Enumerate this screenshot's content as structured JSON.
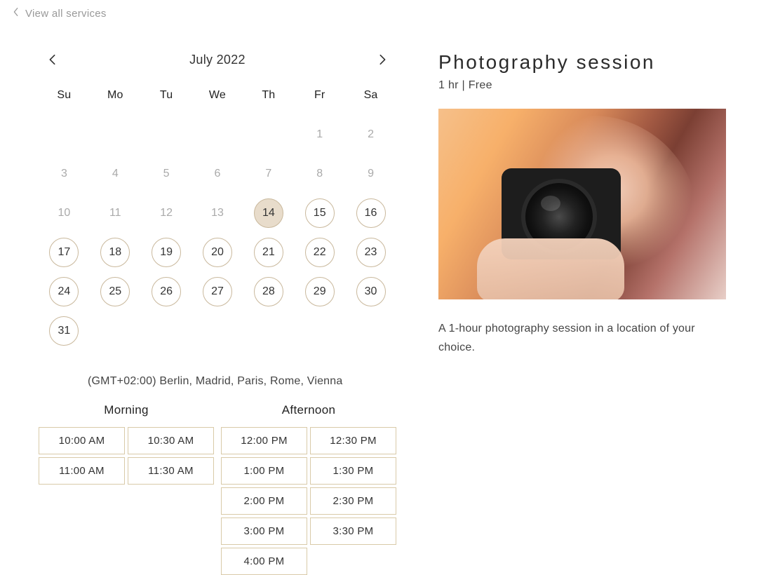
{
  "back": {
    "label": "View all services"
  },
  "calendar": {
    "title": "July 2022",
    "dow": [
      "Su",
      "Mo",
      "Tu",
      "We",
      "Th",
      "Fr",
      "Sa"
    ],
    "leading_blanks": 5,
    "days": [
      {
        "n": "1",
        "state": "disabled"
      },
      {
        "n": "2",
        "state": "disabled"
      },
      {
        "n": "3",
        "state": "disabled"
      },
      {
        "n": "4",
        "state": "disabled"
      },
      {
        "n": "5",
        "state": "disabled"
      },
      {
        "n": "6",
        "state": "disabled"
      },
      {
        "n": "7",
        "state": "disabled"
      },
      {
        "n": "8",
        "state": "disabled"
      },
      {
        "n": "9",
        "state": "disabled"
      },
      {
        "n": "10",
        "state": "disabled"
      },
      {
        "n": "11",
        "state": "disabled"
      },
      {
        "n": "12",
        "state": "disabled"
      },
      {
        "n": "13",
        "state": "disabled"
      },
      {
        "n": "14",
        "state": "selected"
      },
      {
        "n": "15",
        "state": "available"
      },
      {
        "n": "16",
        "state": "available"
      },
      {
        "n": "17",
        "state": "available"
      },
      {
        "n": "18",
        "state": "available"
      },
      {
        "n": "19",
        "state": "available"
      },
      {
        "n": "20",
        "state": "available"
      },
      {
        "n": "21",
        "state": "available"
      },
      {
        "n": "22",
        "state": "available"
      },
      {
        "n": "23",
        "state": "available"
      },
      {
        "n": "24",
        "state": "available"
      },
      {
        "n": "25",
        "state": "available"
      },
      {
        "n": "26",
        "state": "available"
      },
      {
        "n": "27",
        "state": "available"
      },
      {
        "n": "28",
        "state": "available"
      },
      {
        "n": "29",
        "state": "available"
      },
      {
        "n": "30",
        "state": "available"
      },
      {
        "n": "31",
        "state": "available"
      }
    ]
  },
  "timezone": "(GMT+02:00) Berlin, Madrid, Paris, Rome, Vienna",
  "slots": {
    "morning": {
      "title": "Morning",
      "items": [
        "10:00 AM",
        "10:30 AM",
        "11:00 AM",
        "11:30 AM"
      ]
    },
    "afternoon": {
      "title": "Afternoon",
      "items": [
        "12:00 PM",
        "12:30 PM",
        "1:00 PM",
        "1:30 PM",
        "2:00 PM",
        "2:30 PM",
        "3:00 PM",
        "3:30 PM",
        "4:00 PM"
      ]
    }
  },
  "service": {
    "title": "Photography session",
    "meta": "1 hr  |  Free",
    "description": "A 1-hour photography session in a location of your choice."
  }
}
